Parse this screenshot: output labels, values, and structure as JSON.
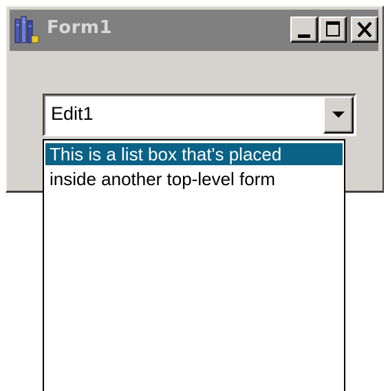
{
  "window": {
    "title": "Form1",
    "icon": "form-app-icon",
    "buttons": {
      "minimize": "minimize-icon",
      "maximize": "maximize-icon",
      "close": "close-icon"
    },
    "colors": {
      "titlebar": "#808080",
      "face": "#d6d3ce"
    }
  },
  "combo": {
    "value": "Edit1",
    "button_icon": "chevron-down-icon"
  },
  "dropdown": {
    "items": [
      {
        "label": "This is a list box that's placed",
        "selected": true
      },
      {
        "label": "inside another top-level form",
        "selected": false
      }
    ],
    "colors": {
      "selection": "#0a6287"
    }
  }
}
